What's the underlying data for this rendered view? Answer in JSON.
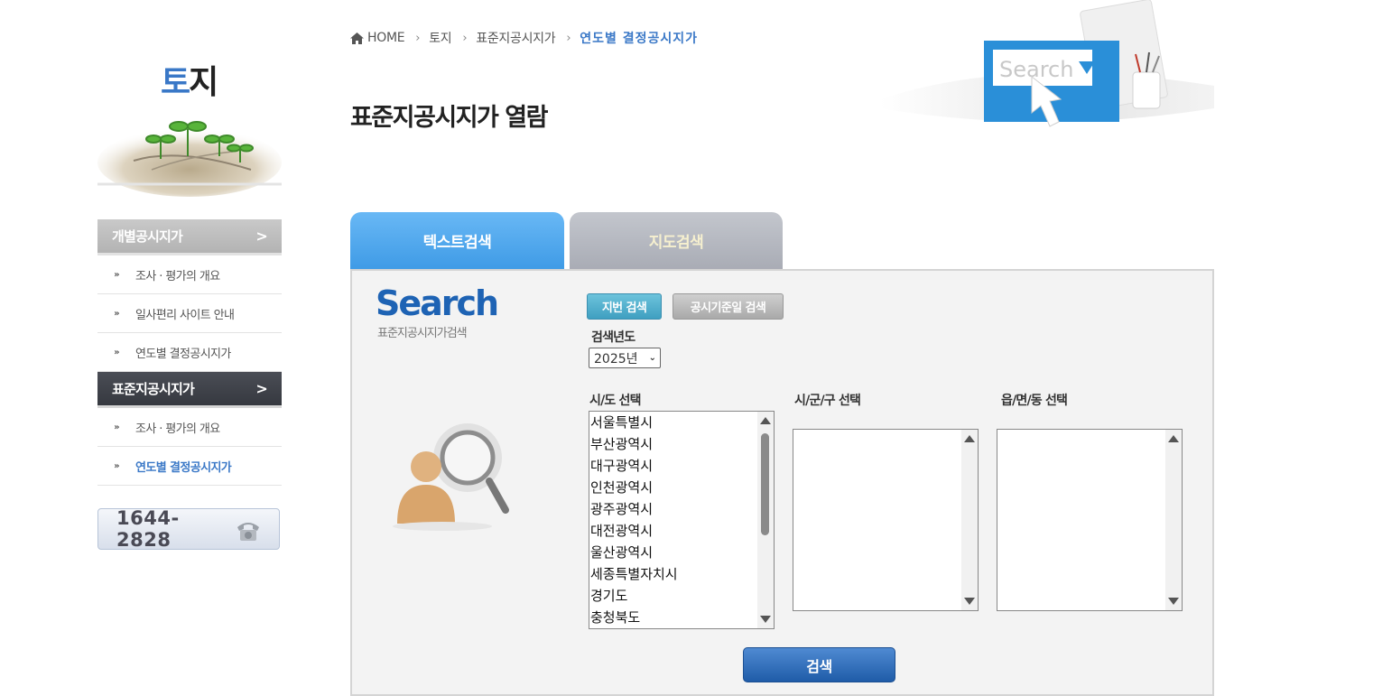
{
  "sidebar": {
    "title_part1": "토",
    "title_part2": "지",
    "sections": [
      {
        "header": "개별공시지가",
        "chevron": ">",
        "items": [
          {
            "label": "조사 · 평가의 개요"
          },
          {
            "label": "일사편리 사이트 안내"
          },
          {
            "label": "연도별 결정공시지가"
          }
        ]
      },
      {
        "header": "표준지공시지가",
        "chevron": ">",
        "items": [
          {
            "label": "조사 · 평가의 개요"
          },
          {
            "label": "연도별 결정공시지가"
          }
        ]
      }
    ],
    "item_marker": "»",
    "phone": "1644-2828"
  },
  "breadcrumb": {
    "home": "HOME",
    "level1": "토지",
    "level2": "표준지공시지가",
    "current": "연도별 결정공시지가",
    "separator": "›"
  },
  "page_title": "표준지공시지가 열람",
  "banner": {
    "search_text": "Search"
  },
  "tabs": [
    {
      "label": "텍스트검색",
      "active": true
    },
    {
      "label": "지도검색",
      "active": false
    }
  ],
  "panel": {
    "logo": "Search",
    "logo_sub": "표준지공시지가검색",
    "mode_buttons": {
      "lot": "지번 검색",
      "date": "공시기준일 검색"
    },
    "year_label": "검색년도",
    "year_value": "2025년",
    "sido_label": "시/도 선택",
    "sigungu_label": "시/군/구 선택",
    "eupmyeon_label": "읍/면/동 선택",
    "sido_options": [
      "서울특별시",
      "부산광역시",
      "대구광역시",
      "인천광역시",
      "광주광역시",
      "대전광역시",
      "울산광역시",
      "세종특별자치시",
      "경기도",
      "충청북도"
    ],
    "search_button": "검색"
  },
  "colors": {
    "accent": "#3a78c7",
    "tab_active": "#4fa9ee",
    "tab_inactive": "#b5b8c0",
    "button_primary": "#2f6db8"
  }
}
